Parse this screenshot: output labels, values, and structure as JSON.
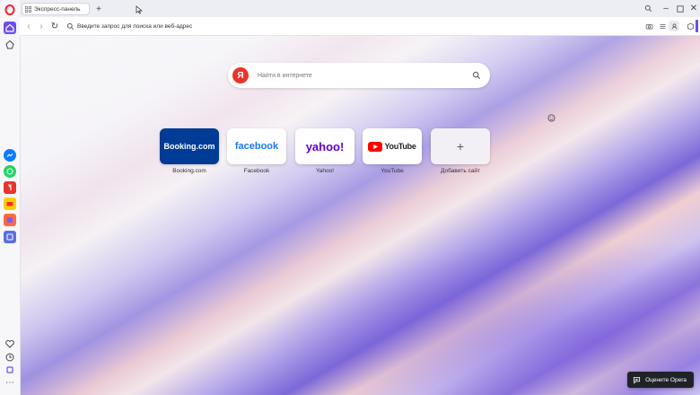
{
  "tab": {
    "title": "Экспресс-панель"
  },
  "address_bar": {
    "placeholder": "Введите запрос для поиска или веб-адрес"
  },
  "search": {
    "placeholder": "Найти в интернете",
    "provider_letter": "Я"
  },
  "speed_dial": [
    {
      "label": "Booking.com",
      "logo_text": "Booking.com",
      "bg": "#003b95",
      "fg": "#ffffff"
    },
    {
      "label": "Facebook",
      "logo_text": "facebook",
      "bg": "#ffffff",
      "fg": "#1877f2"
    },
    {
      "label": "Yahoo!",
      "logo_text": "yahoo!",
      "bg": "#ffffff",
      "fg": "#6001d2"
    },
    {
      "label": "YouTube",
      "logo_text": "YouTube",
      "bg": "#ffffff",
      "fg": "#222222"
    },
    {
      "label": "Добавить сайт",
      "logo_text": "+",
      "bg": "#f2f0f5",
      "fg": "#555555"
    }
  ],
  "rate_button": {
    "label": "Оцените Opera"
  },
  "colors": {
    "opera_red": "#ff1b2d",
    "accent": "#6c4df2",
    "youtube_red": "#ff0000"
  }
}
